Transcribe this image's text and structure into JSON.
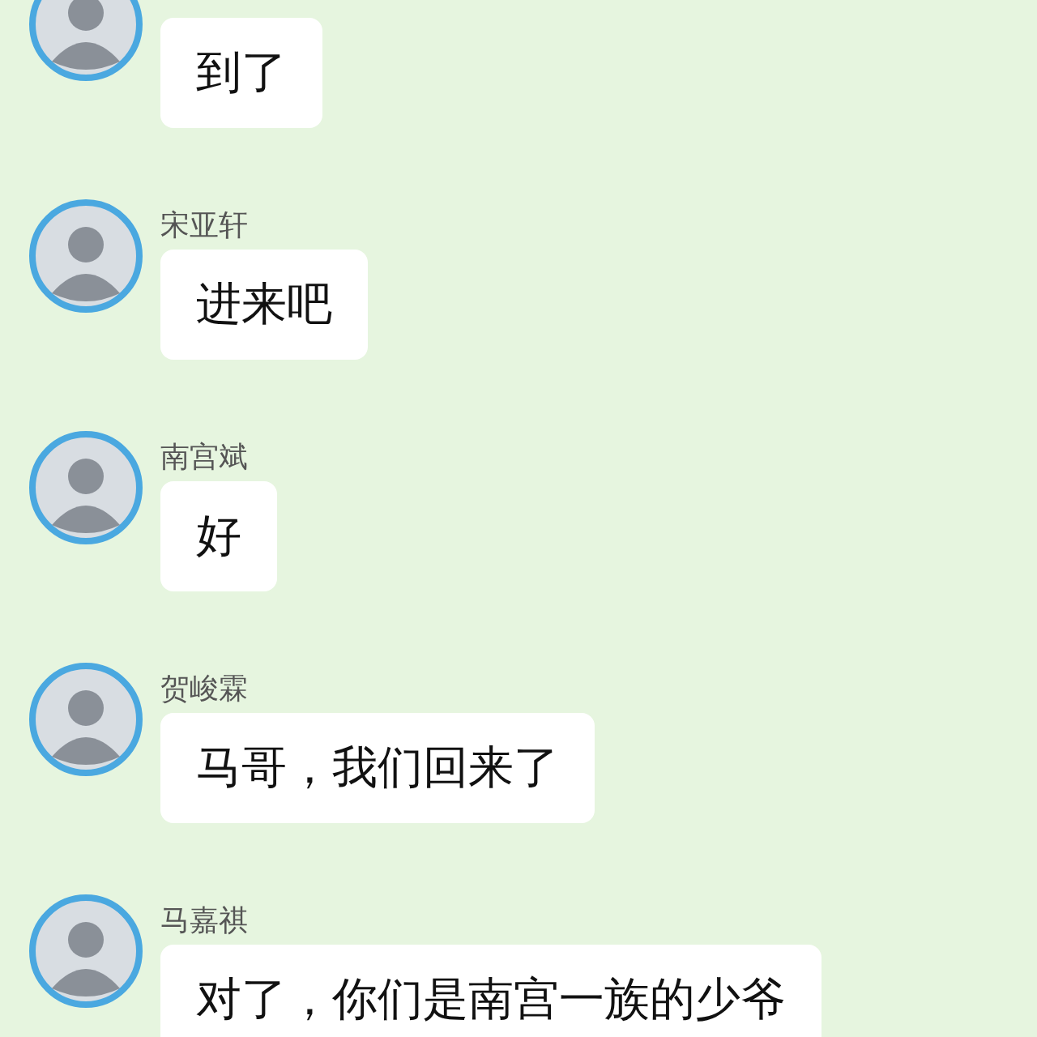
{
  "messages": [
    {
      "text": "到了"
    },
    {
      "name": "宋亚轩",
      "text": "进来吧"
    },
    {
      "name": "南宫斌",
      "text": "好"
    },
    {
      "name": "贺峻霖",
      "text": "马哥，我们回来了"
    },
    {
      "name": "马嘉祺",
      "text": "对了，你们是南宫一族的少爷"
    }
  ]
}
